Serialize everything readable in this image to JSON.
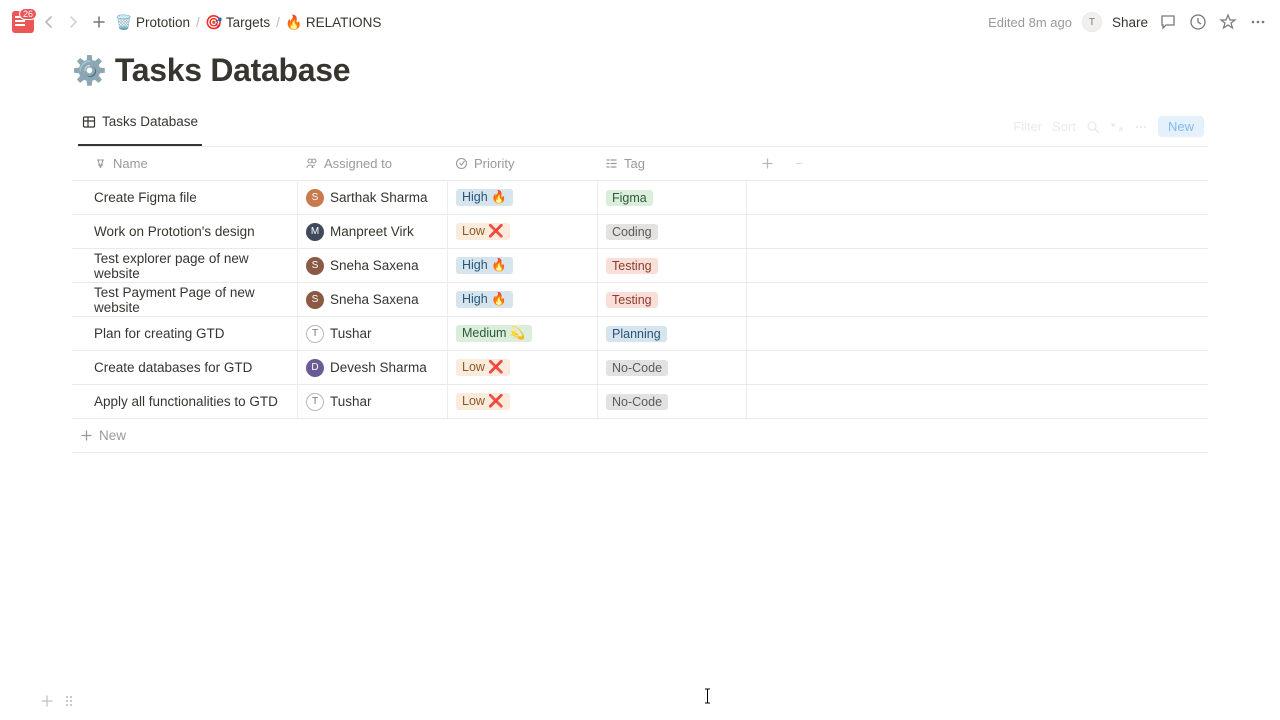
{
  "topbar": {
    "menu_badge": "26",
    "breadcrumb": [
      {
        "icon": "🗑️",
        "label": "Prototion"
      },
      {
        "icon": "🎯",
        "label": "Targets"
      },
      {
        "icon": "🔥",
        "label": "RELATIONS"
      }
    ],
    "edited_label": "Edited 8m ago",
    "share_label": "Share",
    "avatar_initial": "T"
  },
  "page": {
    "title_icon": "⚙️",
    "title": "Tasks Database"
  },
  "view": {
    "tab_label": "Tasks Database",
    "filter_label": "Filter",
    "sort_label": "Sort",
    "new_button": "New"
  },
  "columns": {
    "name": "Name",
    "assigned": "Assigned to",
    "priority": "Priority",
    "tag": "Tag"
  },
  "rows": [
    {
      "name": "Create Figma file",
      "assignee": "Sarthak Sharma",
      "avatar_class": "av-sarthak",
      "avatar_initial": "S",
      "priority": "High 🔥",
      "priority_class": "p-high",
      "tag": "Figma",
      "tag_class": "t-figma"
    },
    {
      "name": "Work on Prototion's design",
      "assignee": "Manpreet Virk",
      "avatar_class": "av-manpreet",
      "avatar_initial": "M",
      "priority": "Low ❌",
      "priority_class": "p-low",
      "tag": "Coding",
      "tag_class": "t-coding"
    },
    {
      "name": "Test explorer page of new website",
      "assignee": "Sneha Saxena",
      "avatar_class": "av-sneha",
      "avatar_initial": "S",
      "priority": "High 🔥",
      "priority_class": "p-high",
      "tag": "Testing",
      "tag_class": "t-testing"
    },
    {
      "name": "Test Payment Page of new website",
      "assignee": "Sneha Saxena",
      "avatar_class": "av-sneha",
      "avatar_initial": "S",
      "priority": "High 🔥",
      "priority_class": "p-high",
      "tag": "Testing",
      "tag_class": "t-testing"
    },
    {
      "name": "Plan for creating GTD",
      "assignee": "Tushar",
      "avatar_class": "av-tushar",
      "avatar_initial": "T",
      "priority": "Medium 💫",
      "priority_class": "p-med",
      "tag": "Planning",
      "tag_class": "t-planning"
    },
    {
      "name": "Create databases for GTD",
      "assignee": "Devesh Sharma",
      "avatar_class": "av-devesh",
      "avatar_initial": "D",
      "priority": "Low ❌",
      "priority_class": "p-low",
      "tag": "No-Code",
      "tag_class": "t-nocode"
    },
    {
      "name": "Apply all functionalities to GTD",
      "assignee": "Tushar",
      "avatar_class": "av-tushar",
      "avatar_initial": "T",
      "priority": "Low ❌",
      "priority_class": "p-low",
      "tag": "No-Code",
      "tag_class": "t-nocode"
    }
  ],
  "new_row_label": "New"
}
